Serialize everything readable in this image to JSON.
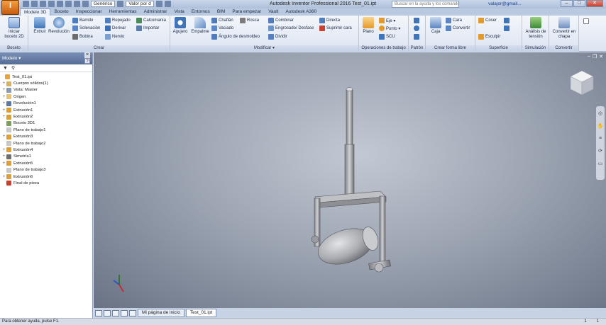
{
  "app": {
    "title": "Autodesk Inventor Professional 2016  Test_01.ipt",
    "app_button_label": "I",
    "qat": {
      "material": "Genérico",
      "appearance": "Valor por d"
    },
    "search_placeholder": "Buscar en la ayuda y los comandos",
    "user": "valajor@gmail...",
    "win_min": "–",
    "win_max": "□",
    "win_close": "✕"
  },
  "tabs": [
    "Modelo 3D",
    "Boceto",
    "Inspeccionar",
    "Herramientas",
    "Administrar",
    "Vista",
    "Entornos",
    "BIM",
    "Para empezar",
    "Vault",
    "Autodesk A360"
  ],
  "ribbon": {
    "boceto": {
      "title": "Boceto",
      "iniciar": "Iniciar boceto 2D"
    },
    "crear": {
      "title": "Crear",
      "extruir": "Extruir",
      "revolucion": "Revolución",
      "barrido": "Barrido",
      "solevacion": "Solevación",
      "bobina": "Bobina",
      "repujado": "Repujado",
      "derivar": "Derivar",
      "nervio": "Nervio",
      "calcomania": "Calcomanía",
      "importar": "Importar"
    },
    "modificar": {
      "title": "Modificar ▾",
      "agujero": "Agujero",
      "empalme": "Empalme",
      "chaflan": "Chaflán",
      "rosca": "Rosca",
      "vaciado": "Vaciado",
      "angulo": "Ángulo de desmoldeo",
      "combinar": "Combinar",
      "engrosado": "Engrosado/ Desfase",
      "dividir": "Dividir",
      "directa": "Directa",
      "suprimir": "Suprimir cara"
    },
    "trabajo": {
      "title": "Operaciones de trabajo",
      "plano": "Plano",
      "eje": "Eje ▾",
      "punto": "Punto ▾",
      "scu": "SCU"
    },
    "patron": {
      "title": "Patrón"
    },
    "forma_libre": {
      "title": "Crear forma libre",
      "caja": "Caja",
      "cara": "Cara",
      "convertir": "Convertir"
    },
    "superficie": {
      "title": "Superficie",
      "coser": "Coser",
      "esculpir": "Esculpir"
    },
    "simulacion": {
      "title": "Simulación",
      "analisis": "Análisis de tensión"
    },
    "convertir": {
      "title": "Convertir",
      "chapa": "Convertir en chapa"
    }
  },
  "browser": {
    "title": "Modelo ▾",
    "close": "×",
    "help": "?",
    "filter_icon": "filter-icon",
    "search_icon": "binoculars-icon",
    "items": [
      {
        "label": "Test_01.ipt",
        "exp": "",
        "color": "#e8a33a"
      },
      {
        "label": "Cuerpos sólidos(1)",
        "exp": "+",
        "color": "#d9b25b"
      },
      {
        "label": "Vista: Master",
        "exp": "+",
        "color": "#8a9bb8"
      },
      {
        "label": "Origen",
        "exp": "+",
        "color": "#e9c46a"
      },
      {
        "label": "Revolución1",
        "exp": "+",
        "color": "#5a78a8"
      },
      {
        "label": "Extrusión1",
        "exp": "+",
        "color": "#e0a030"
      },
      {
        "label": "Extrusión2",
        "exp": "+",
        "color": "#e0a030"
      },
      {
        "label": "Boceto 3D1",
        "exp": "",
        "color": "#7aa05a"
      },
      {
        "label": "Plano de trabajo1",
        "exp": "",
        "color": "#c8c8c8"
      },
      {
        "label": "Extrusión3",
        "exp": "+",
        "color": "#e0a030"
      },
      {
        "label": "Plano de trabajo2",
        "exp": "",
        "color": "#c8c8c8"
      },
      {
        "label": "Extrusión4",
        "exp": "+",
        "color": "#e0a030"
      },
      {
        "label": "Simetría1",
        "exp": "+",
        "color": "#6e6e6e"
      },
      {
        "label": "Extrusión5",
        "exp": "+",
        "color": "#e0a030"
      },
      {
        "label": "Plano de trabajo3",
        "exp": "",
        "color": "#c8c8c8"
      },
      {
        "label": "Extrusión6",
        "exp": "+",
        "color": "#e0a030"
      },
      {
        "label": "Final de pieza",
        "exp": "",
        "color": "#d23a2a"
      }
    ]
  },
  "viewport": {
    "min": "–",
    "restore": "❐",
    "close": "✕"
  },
  "doc_tabs": {
    "home": "Mi página de inicio",
    "doc": "Test_01.ipt"
  },
  "status": {
    "help": "Para obtener ayuda, pulse F1.",
    "count1": "1",
    "count2": "1"
  }
}
